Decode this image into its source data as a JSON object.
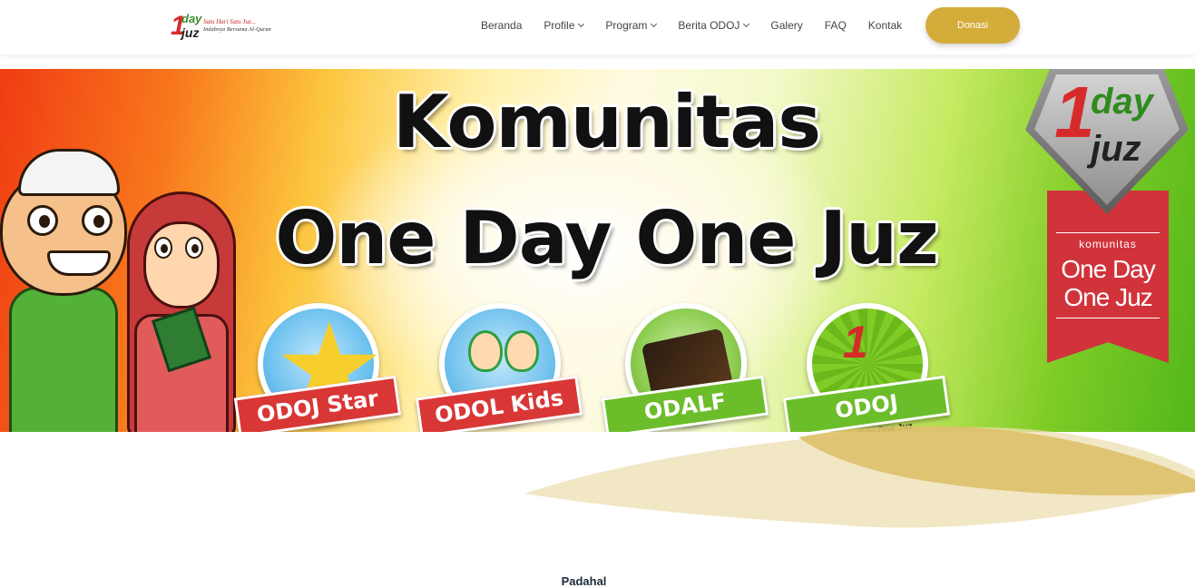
{
  "header": {
    "logo": {
      "tagline_top": "Satu Hari Satu Juz...",
      "tagline_bottom": "Indahnya Bersama Al-Quran"
    },
    "nav": [
      {
        "label": "Beranda",
        "has_dropdown": false
      },
      {
        "label": "Profile",
        "has_dropdown": true
      },
      {
        "label": "Program",
        "has_dropdown": true
      },
      {
        "label": "Berita ODOJ",
        "has_dropdown": true
      },
      {
        "label": "Galery",
        "has_dropdown": false
      },
      {
        "label": "FAQ",
        "has_dropdown": false
      },
      {
        "label": "Kontak",
        "has_dropdown": false
      }
    ],
    "donate_label": "Donasi",
    "donate_color": "#d4ac3a"
  },
  "banner": {
    "title_line1": "Komunitas",
    "title_line2": "One Day One Juz",
    "badges": [
      {
        "label": "ODOJ Star",
        "ribbon_color": "#d93636"
      },
      {
        "label": "ODOL Kids",
        "ribbon_color": "#d93636"
      },
      {
        "label": "ODALF",
        "ribbon_color": "#6cbd2a"
      },
      {
        "label": "ODOJ",
        "subtitle": "One Day One Juz",
        "ribbon_color": "#6cbd2a"
      }
    ],
    "emblem": {
      "number": "1",
      "day": "day",
      "juz": "juz",
      "kom": "komunitas",
      "line1": "One Day",
      "line2": "One Juz"
    }
  },
  "section": {
    "heading": "Padahal"
  }
}
